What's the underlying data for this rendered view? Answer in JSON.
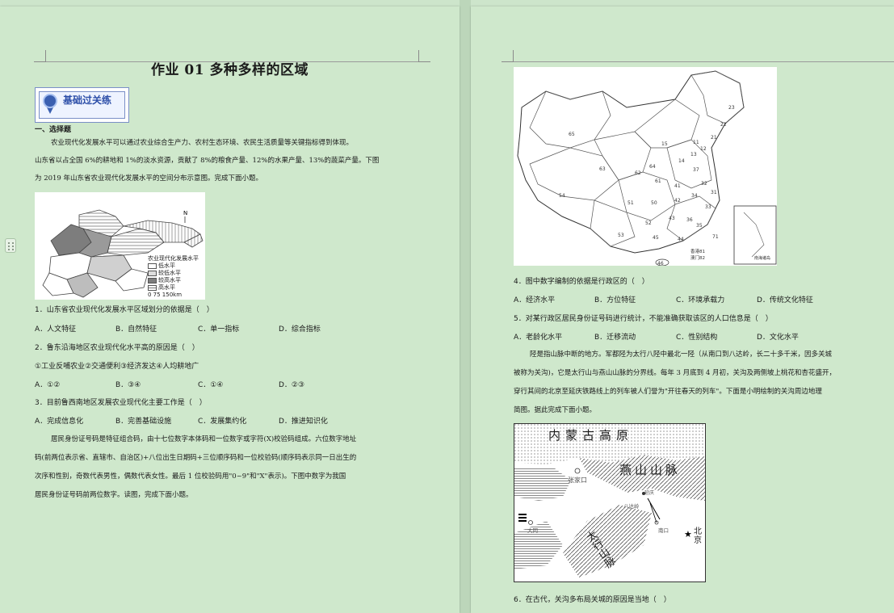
{
  "left": {
    "title": "作业 01 多种多样的区域",
    "badge": "基础过关练",
    "section": "一、选择题",
    "intro": [
      "农业现代化发展水平可以通过农业综合生产力、农村生态环境、农民生活质量等关键指标得到体现。",
      "山东省以占全国 6%的耕地和 1%的淡水资源，贡献了 8%的粮食产量、12%的水果产量、13%的蔬菜产量。下图",
      "为 2019 年山东省农业现代化发展水平的空间分布示意图。完成下面小题。"
    ],
    "map_legend": {
      "title": "农业现代化发展水平",
      "items": [
        "低水平",
        "较低水平",
        "较高水平",
        "高水平"
      ],
      "scale": "0   75   150km",
      "north": "N"
    },
    "questions": [
      {
        "stem": "1．山东省农业现代化发展水平区域划分的依据是（　）",
        "options": [
          "A．人文特征",
          "B．自然特征",
          "C．单一指标",
          "D．综合指标"
        ]
      },
      {
        "stem": "2．鲁东沿海地区农业现代化水平高的原因是（　）",
        "extra": "①工业反哺农业②交通便利③经济发达④人均耕地广",
        "options": [
          "A．①②",
          "B．③④",
          "C．①④",
          "D．②③"
        ]
      },
      {
        "stem": "3．目前鲁西南地区发展农业现代化主要工作是（　）",
        "options": [
          "A．完成信息化",
          "B．完善基础设施",
          "C．发展集约化",
          "D．推进知识化"
        ]
      }
    ],
    "id_paragraph": [
      "居民身份证号码是特征组合码，由十七位数字本体码和一位数字或字符(X)校验码组成。六位数字地址",
      "码(前两位表示省、直辖市、自治区)+八位出生日期码+三位顺序码和一位校验码(顺序码表示同一日出生的",
      "次序和性别，奇数代表男性，偶数代表女性。最后 1 位校验码用\"0~9\"和\"X\"表示)。下图中数字为我国",
      "居民身份证号码前两位数字。读图，完成下面小题。"
    ]
  },
  "right": {
    "china_map_numbers": [
      "23",
      "22",
      "21",
      "65",
      "15",
      "14",
      "13",
      "12",
      "11",
      "63",
      "62",
      "64",
      "61",
      "41",
      "37",
      "32",
      "31",
      "34",
      "54",
      "51",
      "50",
      "42",
      "33",
      "52",
      "43",
      "36",
      "35",
      "53",
      "45",
      "44",
      "71",
      "46"
    ],
    "china_map_inset": "南海诸岛",
    "china_map_hk": "香港81",
    "china_map_mo": "澳门82",
    "questions": [
      {
        "stem": "4．图中数字编制的依据是行政区的（　）",
        "options": [
          "A．经济水平",
          "B．方位特征",
          "C．环境承载力",
          "D．传统文化特征"
        ]
      },
      {
        "stem": "5．对某行政区居民身份证号码进行统计，不能准确获取该区的人口信息是（　）",
        "options": [
          "A．老龄化水平",
          "B．迁移流动",
          "C．性别结构",
          "D．文化水平"
        ]
      }
    ],
    "pass_paragraph": [
      "陉是指山脉中断的地方。军都陉为太行八陉中最北一陉（从南口到八达岭，长二十多千米，因多关城",
      "被称为关沟)，它是太行山与燕山山脉的分界线。每年 3 月底到 4 月初，关沟及两侧坡上桃花和杏花盛开，",
      "穿行其间的北京至延庆铁路线上的列车被人们誉为\"开往春天的列车\"。下面是小明绘制的关沟周边地理",
      "简图。据此完成下面小题。"
    ],
    "pass_map": {
      "plateau": "内蒙古高原",
      "yanshan": "燕山山脉",
      "taihang": "太行山脉",
      "zhangjiakou": "张家口",
      "yanqing": "延庆",
      "badaling": "八达岭",
      "nankou": "南口",
      "datong": "大同",
      "beijing": "北京"
    },
    "q6": "6．在古代，关沟多布局关城的原因是当地（　）"
  }
}
